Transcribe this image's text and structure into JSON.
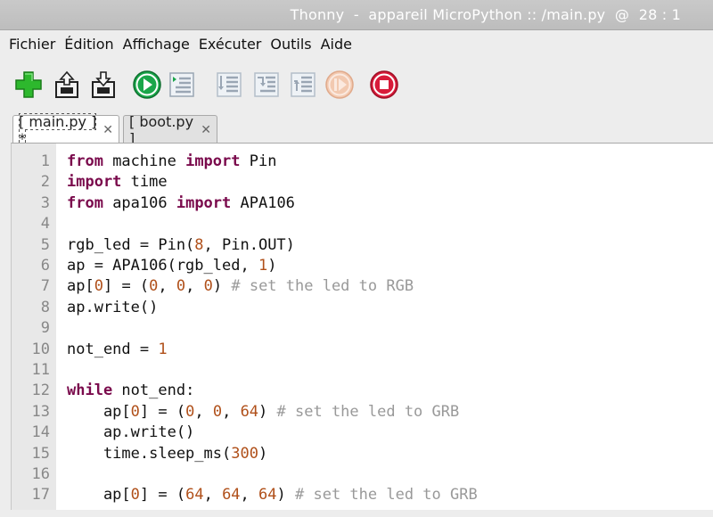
{
  "window": {
    "title": "Thonny  -  appareil MicroPython :: /main.py  @  28 : 1"
  },
  "menu": [
    "Fichier",
    "Édition",
    "Affichage",
    "Exécuter",
    "Outils",
    "Aide"
  ],
  "toolbar": {
    "buttons": [
      {
        "name": "new-file-button",
        "icon": "plus-icon"
      },
      {
        "name": "open-file-button",
        "icon": "open-icon"
      },
      {
        "name": "save-file-button",
        "icon": "save-icon"
      },
      {
        "name": "run-button",
        "icon": "play-icon"
      },
      {
        "name": "debug-button",
        "icon": "debug-icon"
      },
      {
        "name": "step-over-button",
        "icon": "step-over-icon"
      },
      {
        "name": "step-into-button",
        "icon": "step-into-icon"
      },
      {
        "name": "step-out-button",
        "icon": "step-out-icon"
      },
      {
        "name": "resume-button",
        "icon": "resume-icon"
      },
      {
        "name": "stop-button",
        "icon": "stop-icon"
      }
    ],
    "colors": {
      "green": "#2db82d",
      "run": "#1aa64a",
      "stop": "#d81b3a",
      "disabled": "#9aa6b4"
    }
  },
  "tabs": [
    {
      "label": "[ main.py ] *",
      "close": "✕",
      "active": true
    },
    {
      "label": "[ boot.py ]",
      "close": "✕",
      "active": false
    }
  ],
  "editor": {
    "lines": [
      {
        "n": "1",
        "code": "from machine import Pin"
      },
      {
        "n": "2",
        "code": "import time"
      },
      {
        "n": "3",
        "code": "from apa106 import APA106"
      },
      {
        "n": "4",
        "code": ""
      },
      {
        "n": "5",
        "code": "rgb_led = Pin(8, Pin.OUT)"
      },
      {
        "n": "6",
        "code": "ap = APA106(rgb_led, 1)"
      },
      {
        "n": "7",
        "code": "ap[0] = (0, 0, 0) # set the led to RGB"
      },
      {
        "n": "8",
        "code": "ap.write()"
      },
      {
        "n": "9",
        "code": ""
      },
      {
        "n": "10",
        "code": "not_end = 1"
      },
      {
        "n": "11",
        "code": ""
      },
      {
        "n": "12",
        "code": "while not_end:"
      },
      {
        "n": "13",
        "code": "    ap[0] = (0, 0, 64) # set the led to GRB"
      },
      {
        "n": "14",
        "code": "    ap.write()"
      },
      {
        "n": "15",
        "code": "    time.sleep_ms(300)"
      },
      {
        "n": "16",
        "code": ""
      },
      {
        "n": "17",
        "code": "    ap[0] = (64, 64, 64) # set the led to GRB"
      }
    ]
  }
}
